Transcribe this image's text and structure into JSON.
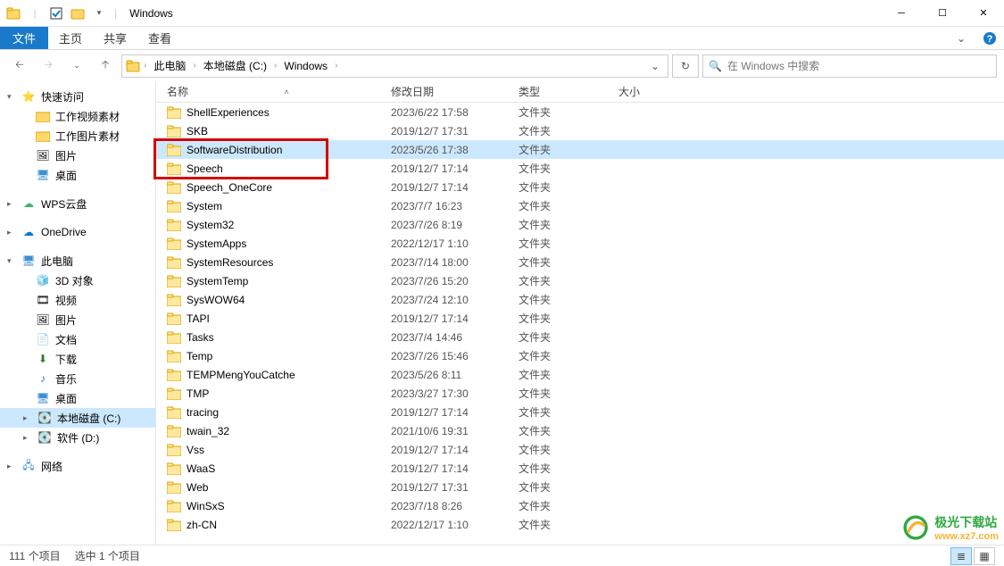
{
  "window": {
    "title": "Windows"
  },
  "ribbon": {
    "file": "文件",
    "tabs": [
      "主页",
      "共享",
      "查看"
    ]
  },
  "breadcrumbs": [
    "此电脑",
    "本地磁盘 (C:)",
    "Windows"
  ],
  "search": {
    "placeholder": "在 Windows 中搜索"
  },
  "columns": {
    "name": "名称",
    "date": "修改日期",
    "type": "类型",
    "size": "大小"
  },
  "type_folder": "文件夹",
  "sidebar": {
    "quick": {
      "label": "快速访问",
      "items": [
        "工作视频素材",
        "工作图片素材",
        "图片",
        "桌面"
      ]
    },
    "wps": "WPS云盘",
    "onedrive": "OneDrive",
    "thispc": {
      "label": "此电脑",
      "items": [
        "3D 对象",
        "视频",
        "图片",
        "文档",
        "下载",
        "音乐",
        "桌面"
      ]
    },
    "drive_c": "本地磁盘 (C:)",
    "drive_d": "软件 (D:)",
    "network": "网络"
  },
  "files": [
    {
      "name": "ShellExperiences",
      "date": "2023/6/22 17:58"
    },
    {
      "name": "SKB",
      "date": "2019/12/7 17:31"
    },
    {
      "name": "SoftwareDistribution",
      "date": "2023/5/26 17:38",
      "selected": true
    },
    {
      "name": "Speech",
      "date": "2019/12/7 17:14"
    },
    {
      "name": "Speech_OneCore",
      "date": "2019/12/7 17:14"
    },
    {
      "name": "System",
      "date": "2023/7/7 16:23"
    },
    {
      "name": "System32",
      "date": "2023/7/26 8:19"
    },
    {
      "name": "SystemApps",
      "date": "2022/12/17 1:10"
    },
    {
      "name": "SystemResources",
      "date": "2023/7/14 18:00"
    },
    {
      "name": "SystemTemp",
      "date": "2023/7/26 15:20"
    },
    {
      "name": "SysWOW64",
      "date": "2023/7/24 12:10"
    },
    {
      "name": "TAPI",
      "date": "2019/12/7 17:14"
    },
    {
      "name": "Tasks",
      "date": "2023/7/4 14:46"
    },
    {
      "name": "Temp",
      "date": "2023/7/26 15:46"
    },
    {
      "name": "TEMPMengYouCatche",
      "date": "2023/5/26 8:11"
    },
    {
      "name": "TMP",
      "date": "2023/3/27 17:30"
    },
    {
      "name": "tracing",
      "date": "2019/12/7 17:14"
    },
    {
      "name": "twain_32",
      "date": "2021/10/6 19:31"
    },
    {
      "name": "Vss",
      "date": "2019/12/7 17:14"
    },
    {
      "name": "WaaS",
      "date": "2019/12/7 17:14"
    },
    {
      "name": "Web",
      "date": "2019/12/7 17:31"
    },
    {
      "name": "WinSxS",
      "date": "2023/7/18 8:26"
    },
    {
      "name": "zh-CN",
      "date": "2022/12/17 1:10"
    }
  ],
  "status": {
    "total": "111 个项目",
    "selected": "选中 1 个项目"
  },
  "watermark": {
    "text": "极光下载站",
    "url": "www.xz7.com"
  }
}
